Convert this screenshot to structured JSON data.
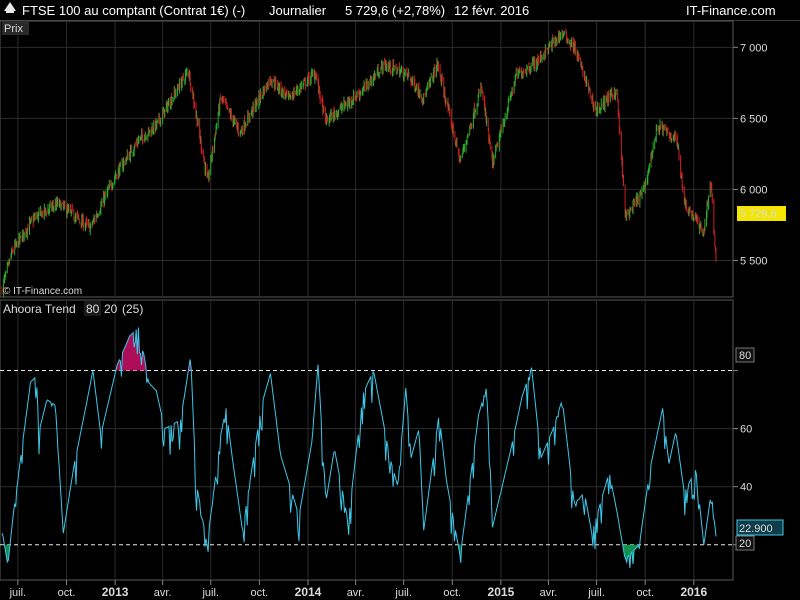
{
  "header": {
    "instrument": "FTSE 100 au comptant (Contrat 1€) (-)",
    "period": "Journalier",
    "quote": "5 729,6 (+2,78%)",
    "date": "12 févr. 2016",
    "brand": "IT-Finance.com"
  },
  "price_panel": {
    "label": "Prix",
    "watermark": "© IT-Finance.com",
    "last_price_label": "5 729,6"
  },
  "indicator_panel": {
    "name": "Ahoora Trend",
    "params": [
      "80",
      "20",
      "(25)"
    ],
    "last_value_label": "22.900",
    "level_high_label": "80",
    "level_low_label": "20"
  },
  "colors": {
    "up": "#2eaa2e",
    "down": "#d02020",
    "indicator": "#3fc7e8",
    "overbought_fill": "#c01060",
    "oversold_fill": "#14a05a",
    "last_price_badge": "#f2e600"
  },
  "chart_data": [
    {
      "type": "candlestick",
      "series_name": "FTSE 100",
      "ylim": [
        5250,
        7150
      ],
      "yticks": [
        5500,
        6000,
        6500,
        7000
      ],
      "ytick_labels": [
        "5 500",
        "6 000",
        "6 500",
        "7 000"
      ],
      "x_ticks": [
        "juil.",
        "oct.",
        "2013",
        "avr.",
        "juil.",
        "oct.",
        "2014",
        "avr.",
        "juil.",
        "oct.",
        "2015",
        "avr.",
        "juil.",
        "oct.",
        "2016"
      ],
      "x_ticks_bold": [
        false,
        false,
        true,
        false,
        false,
        false,
        true,
        false,
        false,
        false,
        true,
        false,
        false,
        false,
        true
      ],
      "anchors": [
        [
          "2012-06-01",
          5300
        ],
        [
          "2012-06-20",
          5560
        ],
        [
          "2012-08-01",
          5800
        ],
        [
          "2012-09-15",
          5900
        ],
        [
          "2012-11-15",
          5730
        ],
        [
          "2013-01-02",
          6100
        ],
        [
          "2013-02-15",
          6350
        ],
        [
          "2013-03-20",
          6450
        ],
        [
          "2013-05-20",
          6840
        ],
        [
          "2013-06-25",
          6050
        ],
        [
          "2013-07-20",
          6650
        ],
        [
          "2013-08-25",
          6400
        ],
        [
          "2013-10-22",
          6780
        ],
        [
          "2013-11-25",
          6640
        ],
        [
          "2014-01-15",
          6820
        ],
        [
          "2014-02-03",
          6480
        ],
        [
          "2014-04-15",
          6700
        ],
        [
          "2014-05-25",
          6880
        ],
        [
          "2014-07-10",
          6800
        ],
        [
          "2014-08-08",
          6640
        ],
        [
          "2014-09-03",
          6880
        ],
        [
          "2014-10-16",
          6200
        ],
        [
          "2014-11-25",
          6720
        ],
        [
          "2014-12-16",
          6180
        ],
        [
          "2015-01-30",
          6800
        ],
        [
          "2015-03-10",
          6900
        ],
        [
          "2015-04-27",
          7100
        ],
        [
          "2015-05-20",
          7000
        ],
        [
          "2015-06-30",
          6550
        ],
        [
          "2015-08-08",
          6700
        ],
        [
          "2015-08-25",
          5800
        ],
        [
          "2015-09-29",
          6000
        ],
        [
          "2015-10-25",
          6450
        ],
        [
          "2015-11-30",
          6350
        ],
        [
          "2015-12-15",
          5900
        ],
        [
          "2016-01-20",
          5700
        ],
        [
          "2016-02-02",
          6050
        ],
        [
          "2016-02-12",
          5500
        ]
      ]
    },
    {
      "type": "line",
      "series_name": "Ahoora Trend",
      "ylim": [
        12,
        95
      ],
      "yticks": [
        20,
        40,
        60,
        80
      ],
      "ytick_labels": [
        "20",
        "40",
        "60",
        "80"
      ],
      "thresholds": [
        80,
        20
      ],
      "cycles": [
        [
          "2012-06-01",
          25
        ],
        [
          "2012-06-12",
          13
        ],
        [
          "2012-06-22",
          30
        ],
        [
          "2012-07-25",
          76
        ],
        [
          "2012-08-05",
          78
        ],
        [
          "2012-08-10",
          59
        ],
        [
          "2012-08-25",
          70
        ],
        [
          "2012-09-10",
          68
        ],
        [
          "2012-09-25",
          24
        ],
        [
          "2012-10-15",
          47
        ],
        [
          "2012-11-05",
          66
        ],
        [
          "2012-11-20",
          80
        ],
        [
          "2012-12-05",
          58
        ],
        [
          "2013-01-05",
          82
        ],
        [
          "2013-01-29",
          92
        ],
        [
          "2013-02-15",
          95
        ],
        [
          "2013-02-25",
          85
        ],
        [
          "2013-03-05",
          76
        ],
        [
          "2013-03-20",
          73
        ],
        [
          "2013-04-05",
          60
        ],
        [
          "2013-05-05",
          63
        ],
        [
          "2013-05-24",
          85
        ],
        [
          "2013-06-03",
          42
        ],
        [
          "2013-06-24",
          20
        ],
        [
          "2013-07-20",
          58
        ],
        [
          "2013-07-30",
          67
        ],
        [
          "2013-08-10",
          51
        ],
        [
          "2013-08-30",
          25
        ],
        [
          "2013-10-05",
          68
        ],
        [
          "2013-10-22",
          79
        ],
        [
          "2013-11-10",
          51
        ],
        [
          "2013-12-15",
          30
        ],
        [
          "2014-01-08",
          55
        ],
        [
          "2014-01-20",
          82
        ],
        [
          "2014-02-04",
          35
        ],
        [
          "2014-02-20",
          53
        ],
        [
          "2014-03-18",
          28
        ],
        [
          "2014-04-15",
          72
        ],
        [
          "2014-05-05",
          80
        ],
        [
          "2014-06-05",
          50
        ],
        [
          "2014-06-20",
          40
        ],
        [
          "2014-07-05",
          74
        ],
        [
          "2014-07-15",
          50
        ],
        [
          "2014-07-30",
          60
        ],
        [
          "2014-08-08",
          25
        ],
        [
          "2014-09-06",
          65
        ],
        [
          "2014-09-20",
          42
        ],
        [
          "2014-10-16",
          16
        ],
        [
          "2014-11-20",
          65
        ],
        [
          "2014-12-06",
          75
        ],
        [
          "2014-12-16",
          26
        ],
        [
          "2015-01-20",
          53
        ],
        [
          "2015-02-10",
          71
        ],
        [
          "2015-02-28",
          81
        ],
        [
          "2015-03-18",
          50
        ],
        [
          "2015-04-10",
          60
        ],
        [
          "2015-04-27",
          70
        ],
        [
          "2015-05-20",
          34
        ],
        [
          "2015-06-08",
          38
        ],
        [
          "2015-06-22",
          24
        ],
        [
          "2015-07-25",
          45
        ],
        [
          "2015-08-10",
          30
        ],
        [
          "2015-08-24",
          15
        ],
        [
          "2015-09-20",
          20
        ],
        [
          "2015-10-10",
          46
        ],
        [
          "2015-11-03",
          67
        ],
        [
          "2015-11-15",
          48
        ],
        [
          "2015-11-28",
          59
        ],
        [
          "2015-12-14",
          38
        ],
        [
          "2016-01-05",
          46
        ],
        [
          "2016-01-20",
          20
        ],
        [
          "2016-02-03",
          38
        ],
        [
          "2016-02-12",
          23
        ]
      ],
      "last_value": 22.9
    }
  ]
}
